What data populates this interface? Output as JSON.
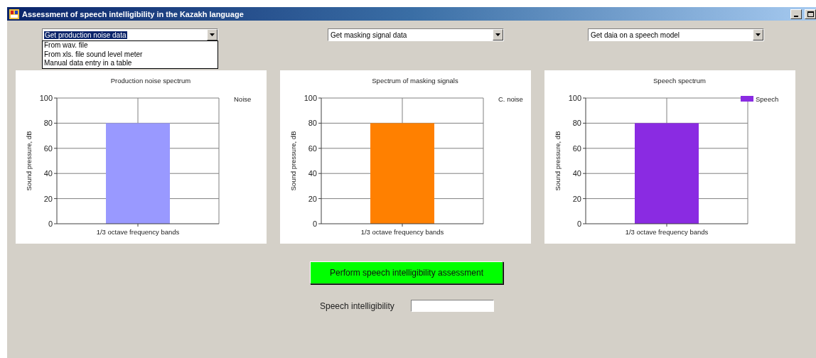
{
  "window": {
    "title": "Assessment of speech intelligibility in the Kazakh language"
  },
  "combos": [
    {
      "value": "Get production noise data",
      "highlighted": true,
      "expanded": true,
      "options": [
        "From wav. file",
        "From xls. file sound level meter",
        "Manual data entry in a table"
      ]
    },
    {
      "value": "Get masking signal data",
      "highlighted": false
    },
    {
      "value": "Get daia on a speech model",
      "highlighted": false
    }
  ],
  "charts": [
    {
      "legend_swatch": false,
      "chart_data": {
        "type": "bar",
        "grid": true,
        "title": "Production noise spectrum",
        "xlabel": "1/3 octave frequency bands",
        "ylabel": "Sound pressure, dB",
        "ylim": [
          0,
          100
        ],
        "yticks": [
          0,
          20,
          40,
          60,
          80,
          100
        ],
        "series": [
          {
            "name": "Noise",
            "color": "#9999ff",
            "values": [
              80
            ]
          }
        ]
      }
    },
    {
      "legend_swatch": false,
      "chart_data": {
        "type": "bar",
        "grid": true,
        "title": "Spectrum of masking signals",
        "xlabel": "1/3 octave frequency bands",
        "ylabel": "Sound pressure, dB",
        "ylim": [
          0,
          100
        ],
        "yticks": [
          0,
          20,
          40,
          60,
          80,
          100
        ],
        "series": [
          {
            "name": "C. noise",
            "color": "#ff8000",
            "values": [
              80
            ]
          }
        ]
      }
    },
    {
      "legend_swatch": true,
      "chart_data": {
        "type": "bar",
        "grid": true,
        "title": "Speech spectrum",
        "xlabel": "1/3 octave frequency bands",
        "ylabel": "Sound pressure, dB",
        "ylim": [
          0,
          100
        ],
        "yticks": [
          0,
          20,
          40,
          60,
          80,
          100
        ],
        "series": [
          {
            "name": "Speech",
            "color": "#8a2be2",
            "values": [
              80
            ]
          }
        ]
      }
    }
  ],
  "assess_button": "Perform speech intelligibility assessment",
  "result": {
    "label": "Speech intelligibility"
  }
}
